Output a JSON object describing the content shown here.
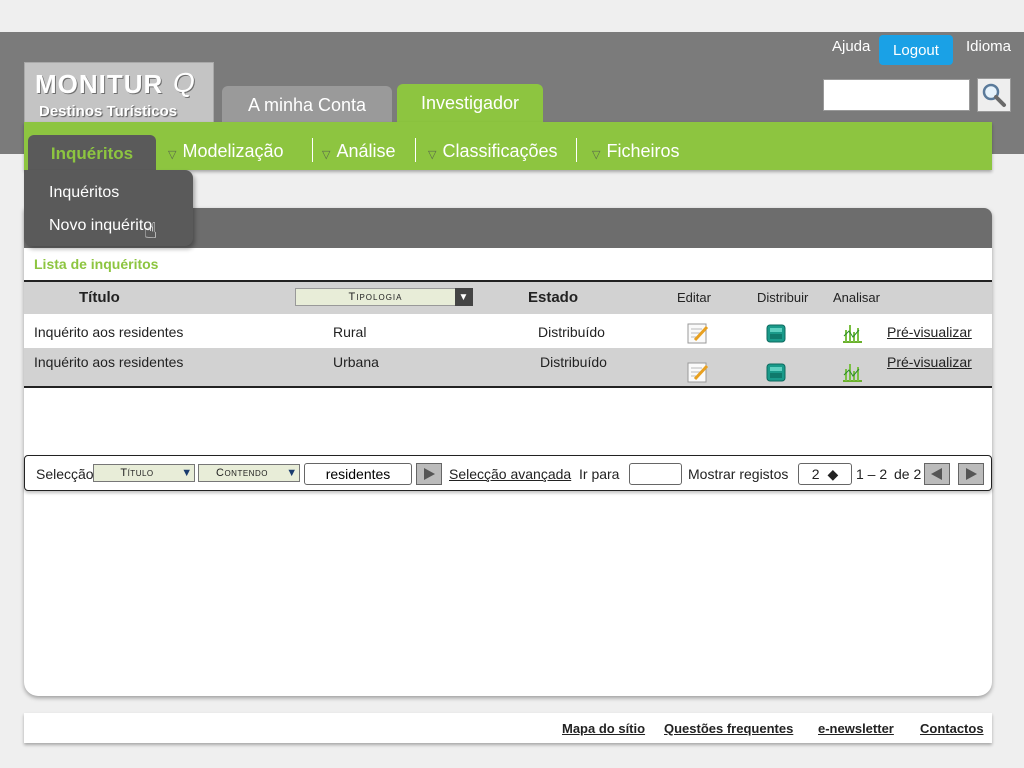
{
  "logo": {
    "title": "MONITUR",
    "title_q": "Q",
    "subtitle": "Destinos Turísticos"
  },
  "top_links": {
    "help": "Ajuda",
    "logout": "Logout",
    "language": "Idioma"
  },
  "search": {
    "value": "",
    "icon": "magnifier-icon"
  },
  "tabs": [
    {
      "label": "A minha Conta"
    },
    {
      "label": "Investigador",
      "active": true
    }
  ],
  "nav": {
    "active": "Inquéritos",
    "items": [
      {
        "label": "Modelização"
      },
      {
        "label": "Análise"
      },
      {
        "label": "Classificações"
      },
      {
        "label": "Ficheiros"
      }
    ]
  },
  "dropdown": {
    "items": [
      {
        "label": "Inquéritos"
      },
      {
        "label": "Novo inquérito"
      }
    ]
  },
  "list": {
    "title": "Lista de inquéritos",
    "headers": {
      "title": "Título",
      "typology": "Tipologia",
      "state": "Estado",
      "edit": "Editar",
      "distribute": "Distribuir",
      "analyse": "Analisar"
    },
    "rows": [
      {
        "title": "Inquérito  aos residentes",
        "typology": "Rural",
        "state": "Distribuído",
        "preview": "Pré-visualizar"
      },
      {
        "title": "Inquérito aos residentes",
        "typology": "Urbana",
        "state": "Distribuído",
        "preview": "Pré-visualizar"
      }
    ]
  },
  "selection": {
    "label": "Selecção",
    "field": "Título",
    "operator": "Contendo",
    "value": "residentes",
    "advanced": "Selecção avançada",
    "goto_label": "Ir para",
    "goto_value": "",
    "show_label": "Mostrar registos",
    "show_value": "2",
    "range": "1 – 2",
    "of": "de 2"
  },
  "footer": {
    "links": [
      "Mapa do sítio",
      "Questões frequentes",
      "e-newsletter",
      "Contactos"
    ]
  },
  "colors": {
    "brand_green": "#8dc540",
    "header_gray": "#7b7b7b",
    "logout_blue": "#1aa1e6",
    "dark_gray": "#5a5a5a"
  }
}
